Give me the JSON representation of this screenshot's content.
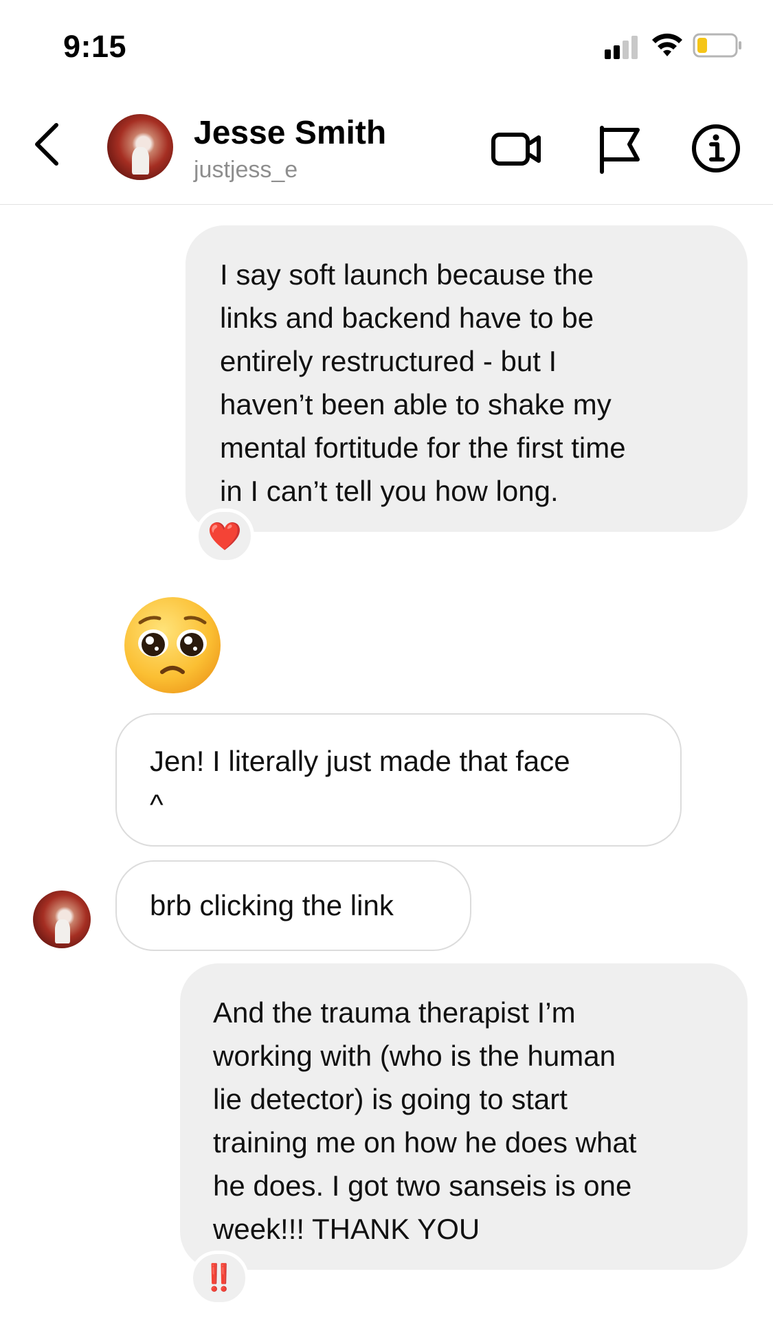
{
  "status_bar": {
    "time": "9:15",
    "battery_color": "#f5c518"
  },
  "header": {
    "contact_name": "Jesse Smith",
    "contact_username": "justjess_e",
    "icons": [
      "back-chevron-icon",
      "video-camera-icon",
      "flag-icon",
      "info-icon"
    ]
  },
  "messages": [
    {
      "sender": "me",
      "text": "I say soft launch because the\nlinks and backend have to be\nentirely restructured - but I\nhaven’t been able to shake my\nmental fortitude for the first time\nin I can’t tell you how long.",
      "reaction": "❤️"
    },
    {
      "sender": "them",
      "emoji": "pleading-face"
    },
    {
      "sender": "them",
      "text": "Jen! I literally just made that face\n^"
    },
    {
      "sender": "them",
      "text": "brb clicking the link"
    },
    {
      "sender": "me",
      "text": "And the trauma therapist I’m\nworking with (who is the human\nlie detector) is going to start\ntraining me on how he does what\nhe does. I got two sanseis is one\nweek!!! THANK YOU",
      "reaction": "‼️"
    }
  ],
  "colors": {
    "my_bubble": "#efefef",
    "their_bubble_border": "#dcdcdc",
    "username_gray": "#8e8e8e",
    "reaction_red": "#e0201b"
  }
}
